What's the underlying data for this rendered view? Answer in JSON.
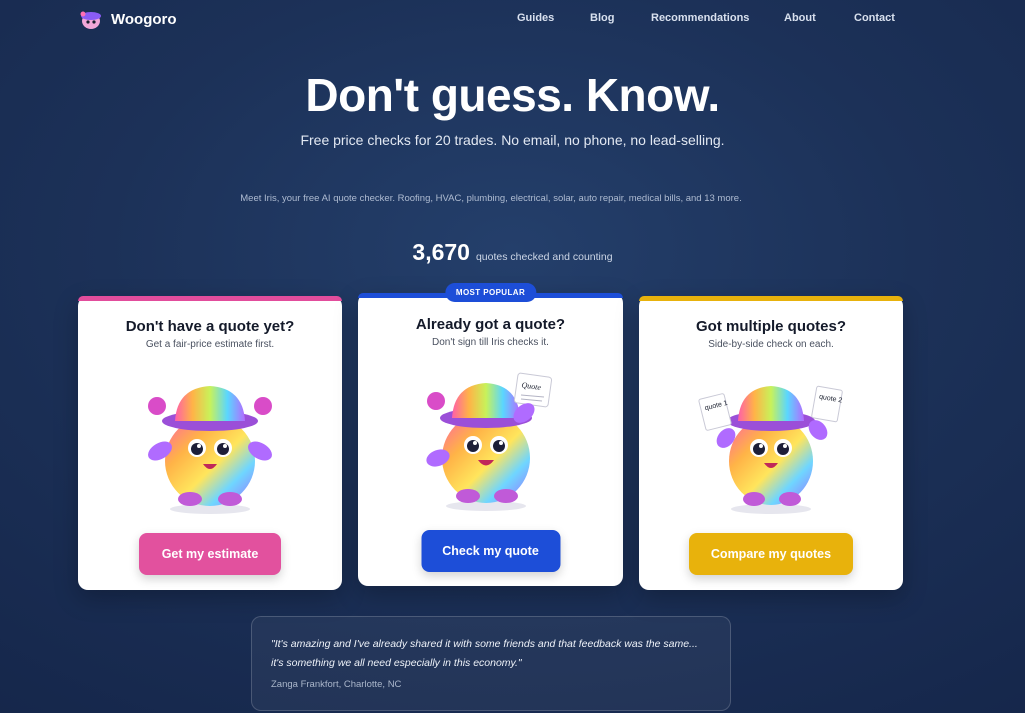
{
  "brand": {
    "name": "Woogoro"
  },
  "nav": {
    "links": [
      "Guides",
      "Blog",
      "Recommendations",
      "About",
      "Contact"
    ]
  },
  "hero": {
    "title": "Don't guess. Know.",
    "subtitle": "Free price checks for 20 trades. No email, no phone, no lead-selling.",
    "intro": "Meet Iris, your free AI quote checker. Roofing, HVAC, plumbing, electrical, solar, auto repair, medical bills, and 13 more.",
    "counter_value": "3,670",
    "counter_label": "quotes checked and counting"
  },
  "cards": [
    {
      "title": "Don't have a quote yet?",
      "subtitle": "Get a fair-price estimate first.",
      "button": "Get my estimate",
      "accent": "#e24d9c",
      "mascot": "mascot-waving-icon"
    },
    {
      "badge": "MOST POPULAR",
      "title": "Already got a quote?",
      "subtitle": "Don't sign till Iris checks it.",
      "button": "Check my quote",
      "quote_card_label": "Quote",
      "accent": "#1d4ed8",
      "mascot": "mascot-holding-quote-icon"
    },
    {
      "title": "Got multiple quotes?",
      "subtitle": "Side-by-side check on each.",
      "button": "Compare my quotes",
      "quote_card_1": "quote 1",
      "quote_card_2": "quote 2",
      "accent": "#e8b20c",
      "mascot": "mascot-comparing-quotes-icon"
    }
  ],
  "testimonial": {
    "text": "\"It's amazing and I've already shared it with some friends and that feedback was the same... it's something we all need especially in this economy.\"",
    "author": "Zanga Frankfort, Charlotte, NC"
  }
}
